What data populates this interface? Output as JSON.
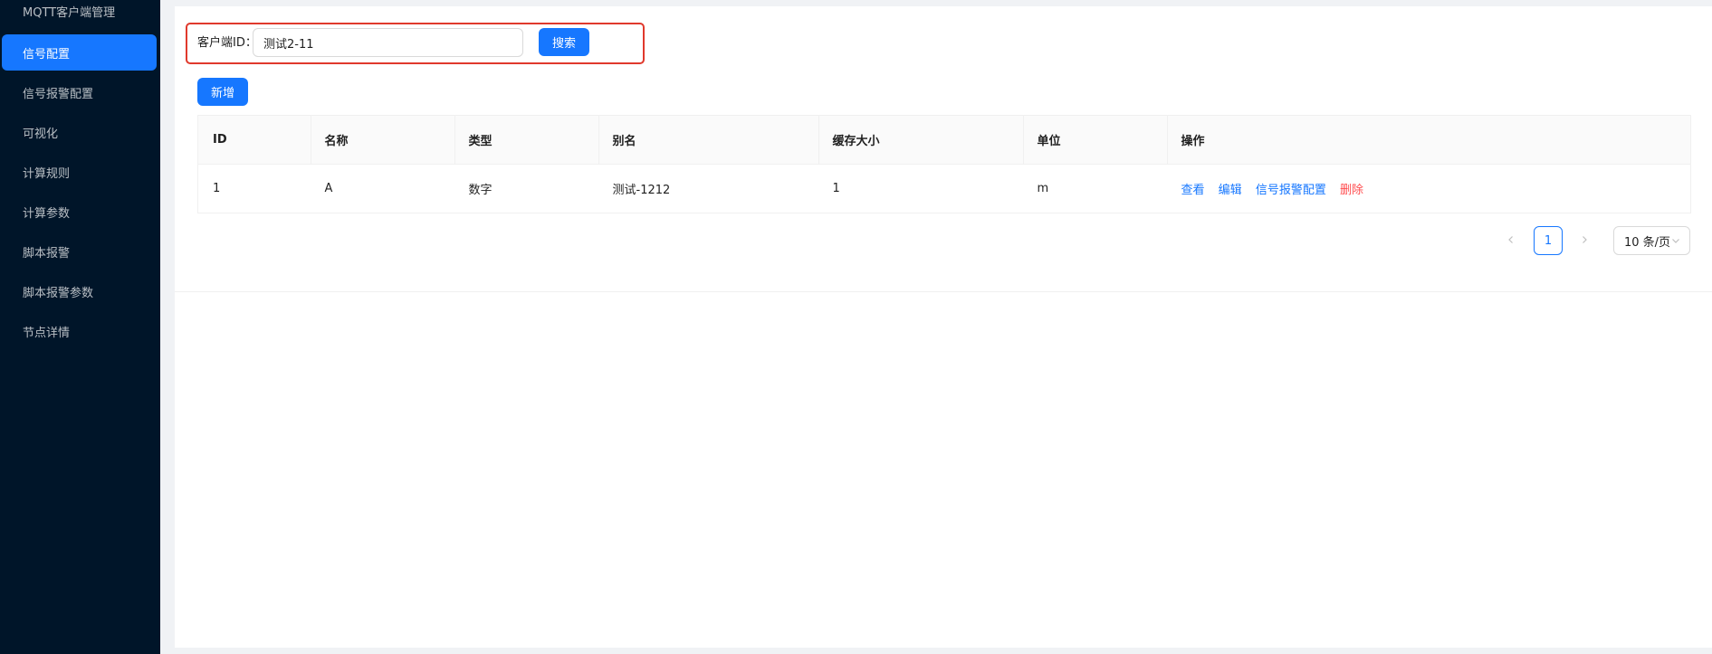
{
  "sidebar": {
    "items": [
      {
        "label": "MQTT客户端管理"
      },
      {
        "label": "信号配置"
      },
      {
        "label": "信号报警配置"
      },
      {
        "label": "可视化"
      },
      {
        "label": "计算规则"
      },
      {
        "label": "计算参数"
      },
      {
        "label": "脚本报警"
      },
      {
        "label": "脚本报警参数"
      },
      {
        "label": "节点详情"
      }
    ],
    "active_label": "信号配置"
  },
  "search": {
    "label": "客户端ID：",
    "value": "测试2-11",
    "button_label": "搜索"
  },
  "toolbar": {
    "add_label": "新增"
  },
  "table": {
    "columns": [
      "ID",
      "名称",
      "类型",
      "别名",
      "缓存大小",
      "单位",
      "操作"
    ],
    "rows": [
      {
        "id": "1",
        "name": "A",
        "type": "数字",
        "alias": "测试-1212",
        "cache_size": "1",
        "unit": "m",
        "actions": {
          "view": "查看",
          "edit": "编辑",
          "alarm_config": "信号报警配置",
          "delete": "删除"
        }
      }
    ]
  },
  "pagination": {
    "prev_icon": "chevron-left-icon",
    "next_icon": "chevron-right-icon",
    "current_page": "1",
    "page_size_label": "10 条/页"
  },
  "colors": {
    "sidebar_bg": "#001529",
    "primary": "#1677ff",
    "danger": "#ff4d4f",
    "highlight_frame": "#e0392c"
  }
}
